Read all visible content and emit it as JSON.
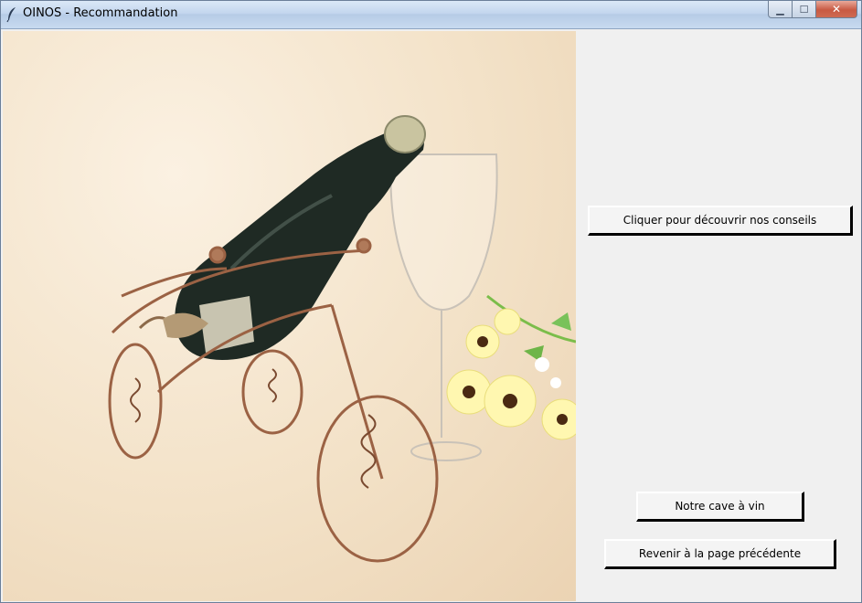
{
  "window": {
    "title": "OINOS - Recommandation",
    "controls": {
      "minimize": "▁",
      "maximize": "☐",
      "close": "✕"
    }
  },
  "photo": {
    "description_icon": "wine-bottle-tricycle-photo"
  },
  "buttons": {
    "advice": "Cliquer pour découvrir nos conseils",
    "cellar": "Notre cave à vin",
    "back": "Revenir à la page précédente"
  },
  "colors": {
    "client_bg": "#f0f0f0",
    "button_bg": "#f4f4f4"
  }
}
